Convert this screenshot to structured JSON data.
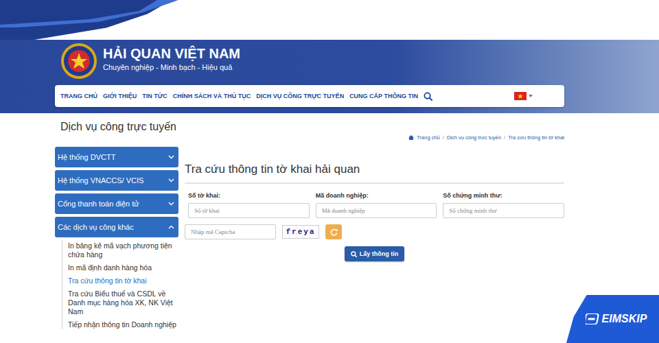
{
  "header": {
    "title": "HẢI QUAN VIỆT NAM",
    "slogan": "Chuyên nghiệp - Minh bạch - Hiệu quả"
  },
  "nav": {
    "items": [
      "TRANG CHỦ",
      "GIỚI THIỆU",
      "TIN TỨC",
      "CHÍNH SÁCH VÀ THỦ TỤC",
      "DỊCH VỤ CÔNG TRỰC TUYẾN",
      "CUNG CẤP THÔNG TIN"
    ]
  },
  "page_title": "Dịch vụ công trực tuyến",
  "breadcrumb": {
    "separator": "/",
    "items": [
      "Trang chủ",
      "Dịch vụ công trực tuyến",
      "Tra cứu thông tin tờ khai"
    ]
  },
  "sidebar": {
    "groups": [
      {
        "label": "Hệ thống DVCTT",
        "expanded": false,
        "items": []
      },
      {
        "label": "Hệ thống VNACCS/ VCIS",
        "expanded": false,
        "items": []
      },
      {
        "label": "Cổng thanh toán điện tử",
        "expanded": false,
        "items": []
      },
      {
        "label": "Các dịch vụ công khác",
        "expanded": true,
        "items": [
          {
            "label": "In bảng kê mã vạch phương tiện chứa hàng",
            "selected": false
          },
          {
            "label": "In mã định danh hàng hóa",
            "selected": false
          },
          {
            "label": "Tra cứu thông tin tờ khai",
            "selected": true
          },
          {
            "label": "Tra cứu Biểu thuế và CSDL về Danh mục hàng hóa XK, NK Việt Nam",
            "selected": false
          },
          {
            "label": "Tiếp nhận thông tin Doanh nghiệp",
            "selected": false
          }
        ]
      }
    ]
  },
  "form": {
    "title": "Tra cứu thông tin tờ khai hải quan",
    "fields": [
      {
        "label": "Số tờ khai:",
        "placeholder": "Số tờ khai"
      },
      {
        "label": "Mã doanh nghiệp:",
        "placeholder": "Mã doanh nghiệp"
      },
      {
        "label": "Số chứng minh thư:",
        "placeholder": "Số chứng minh thư"
      }
    ],
    "captcha": {
      "placeholder": "Nhập mã Captcha",
      "code": "freya"
    },
    "submit": "Lấy thông tin"
  },
  "watermark": {
    "brand": "EIMSKIP"
  }
}
